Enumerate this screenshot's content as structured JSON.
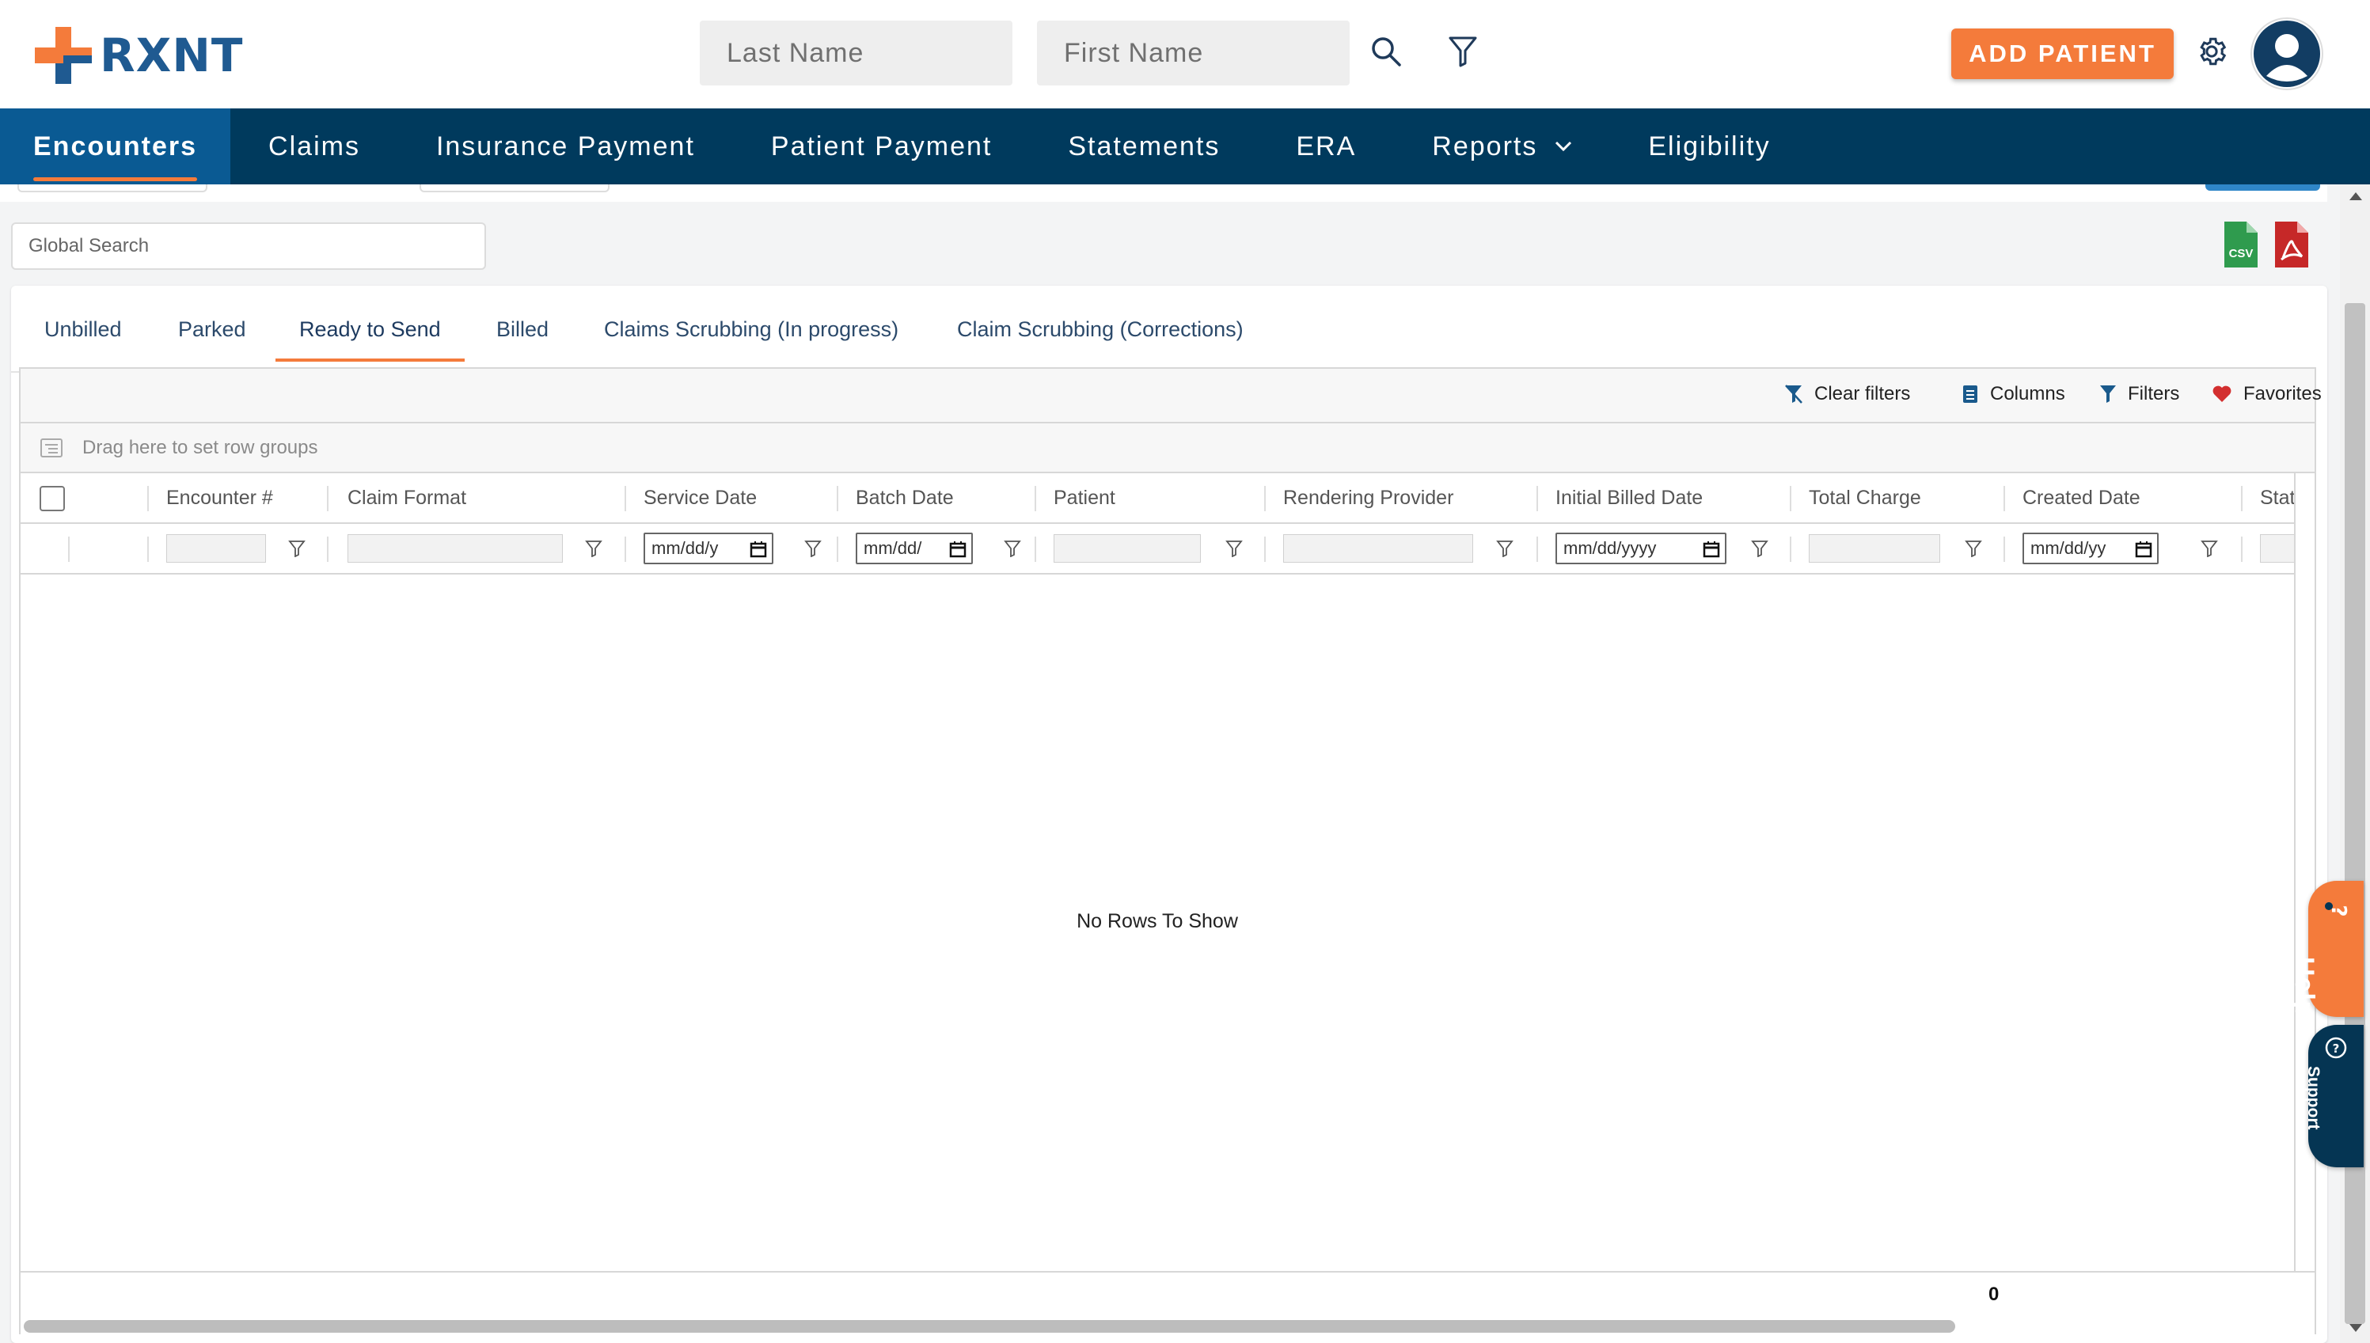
{
  "app": {
    "brand": "RXNT",
    "colors": {
      "brand_blue": "#1f5a91",
      "nav_bg": "#003a5d",
      "nav_active": "#0a5a93",
      "accent_orange": "#f47b3b"
    }
  },
  "header": {
    "last_name_placeholder": "Last Name",
    "first_name_placeholder": "First Name",
    "add_patient_label": "ADD PATIENT",
    "icons": [
      "search-icon",
      "funnel-icon",
      "gear-icon",
      "avatar"
    ]
  },
  "nav": {
    "items": [
      {
        "label": "Encounters",
        "active": true
      },
      {
        "label": "Claims"
      },
      {
        "label": "Insurance Payment"
      },
      {
        "label": "Patient Payment"
      },
      {
        "label": "Statements"
      },
      {
        "label": "ERA"
      },
      {
        "label": "Reports",
        "dropdown": true
      },
      {
        "label": "Eligibility"
      }
    ]
  },
  "toolbar": {
    "global_search_placeholder": "Global Search",
    "export": [
      "csv-icon",
      "pdf-icon"
    ]
  },
  "tabs": [
    {
      "label": "Unbilled"
    },
    {
      "label": "Parked"
    },
    {
      "label": "Ready to Send",
      "active": true
    },
    {
      "label": "Billed"
    },
    {
      "label": "Claims Scrubbing (In progress)"
    },
    {
      "label": "Claim Scrubbing (Corrections)"
    }
  ],
  "grid": {
    "tools": {
      "clear_filters": "Clear filters",
      "columns": "Columns",
      "filters": "Filters",
      "favorites": "Favorites"
    },
    "row_group_hint": "Drag here to set row groups",
    "columns": [
      "Encounter #",
      "Claim Format",
      "Service Date",
      "Batch Date",
      "Patient",
      "Rendering Provider",
      "Initial Billed Date",
      "Total Charge",
      "Created Date",
      "Statu"
    ],
    "date_placeholders": {
      "service_date": "mm/dd/y",
      "batch_date": "mm/dd/",
      "initial_billed_date": "mm/dd/yyyy",
      "created_date": "mm/dd/yy"
    },
    "empty_message": "No Rows To Show",
    "footer_total": "0"
  },
  "side_tabs": {
    "help": "Help",
    "support": "Support"
  }
}
